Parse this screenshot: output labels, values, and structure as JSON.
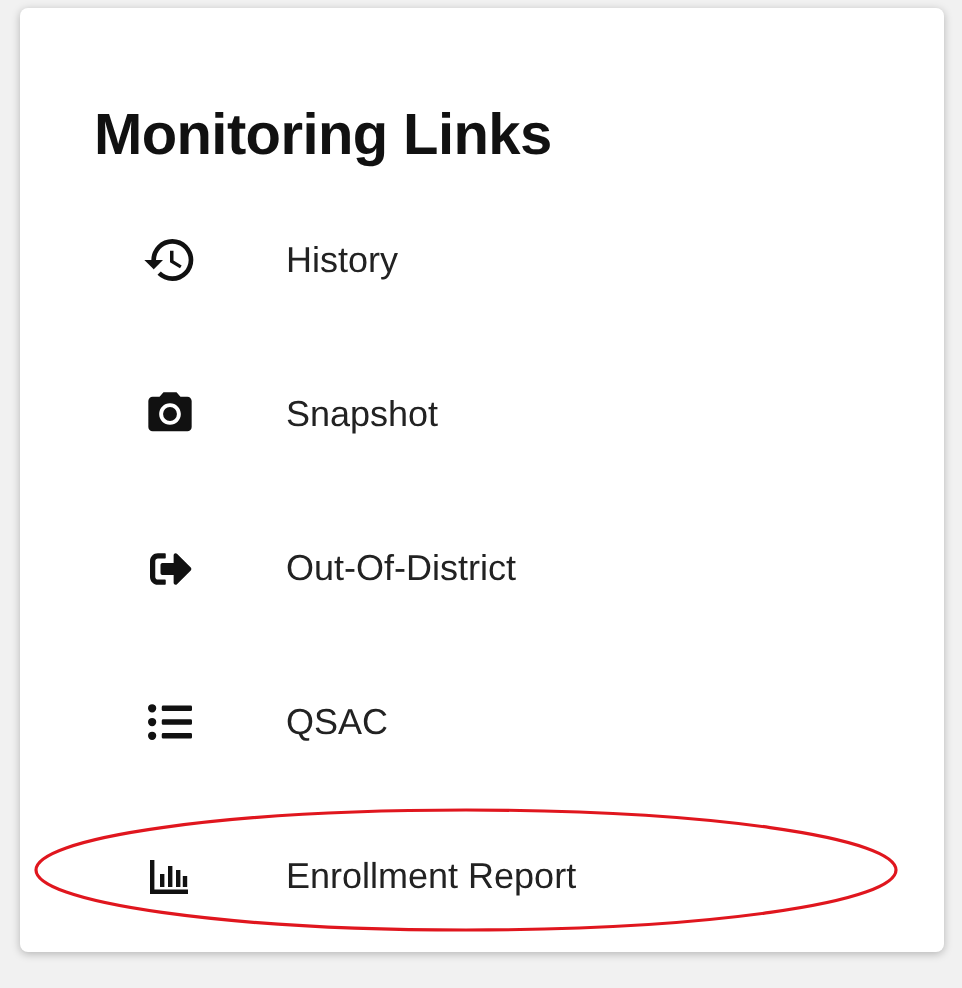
{
  "card": {
    "title": "Monitoring Links"
  },
  "links": [
    {
      "label": "History",
      "highlighted": false
    },
    {
      "label": "Snapshot",
      "highlighted": false
    },
    {
      "label": "Out-Of-District",
      "highlighted": false
    },
    {
      "label": "QSAC",
      "highlighted": false
    },
    {
      "label": "Enrollment Report",
      "highlighted": true
    }
  ]
}
